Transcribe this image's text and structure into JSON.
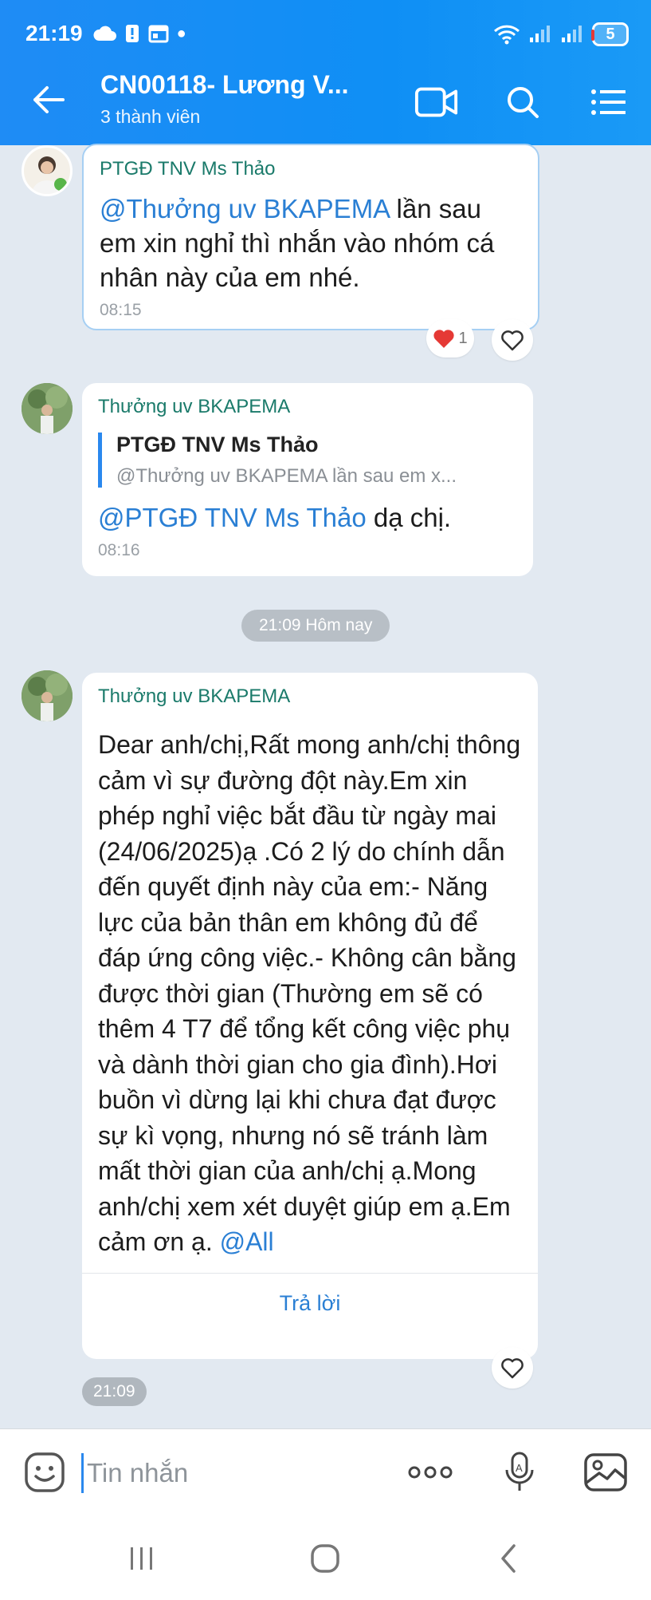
{
  "status_bar": {
    "time": "21:19",
    "battery": "5"
  },
  "header": {
    "title": "CN00118- Lương V...",
    "subtitle": "3 thành viên"
  },
  "messages": [
    {
      "sender": "PTGĐ TNV Ms Thảo",
      "mention": "@Thưởng uv BKAPEMA",
      "text": " lần sau em xin nghỉ thì nhắn vào nhóm cá nhân này của em nhé.",
      "time": "08:15",
      "reaction_count": "1"
    },
    {
      "sender": "Thưởng uv BKAPEMA",
      "quote_name": "PTGĐ TNV Ms Thảo",
      "quote_text": "@Thưởng uv BKAPEMA  lần sau em x...",
      "mention": "@PTGĐ TNV Ms Thảo",
      "text": " dạ chị.",
      "time": "08:16"
    },
    {
      "sender": "Thưởng uv BKAPEMA",
      "text": "Dear anh/chị,Rất mong anh/chị thông cảm vì sự đường đột này.Em xin phép nghỉ việc bắt đầu từ ngày mai (24/06/2025)ạ .Có 2 lý do chính dẫn đến quyết định này của em:- Năng lực của bản thân em không đủ để đáp ứng công việc.- Không cân bằng được thời gian (Thường em sẽ có thêm 4 T7 để tổng kết công việc phụ và dành thời gian cho gia đình).Hơi buồn vì dừng lại khi chưa đạt được sự kì vọng, nhưng nó sẽ tránh làm mất thời gian của anh/chị ạ.Mong anh/chị xem xét duyệt giúp em ạ.Em cảm ơn ạ. ",
      "mention": "@All",
      "reply_label": "Trả lời",
      "time": "21:09"
    }
  ],
  "date_separator": "21:09 Hôm nay",
  "composer": {
    "placeholder": "Tin nhắn"
  },
  "icons": [
    "back-arrow",
    "video-call",
    "search",
    "menu",
    "sticker",
    "more",
    "voice",
    "image",
    "heart"
  ],
  "colors": {
    "header": "#1a8ff5",
    "mention": "#2a7fd4",
    "sender": "#1a7a6a",
    "background": "#e2e9f1"
  }
}
